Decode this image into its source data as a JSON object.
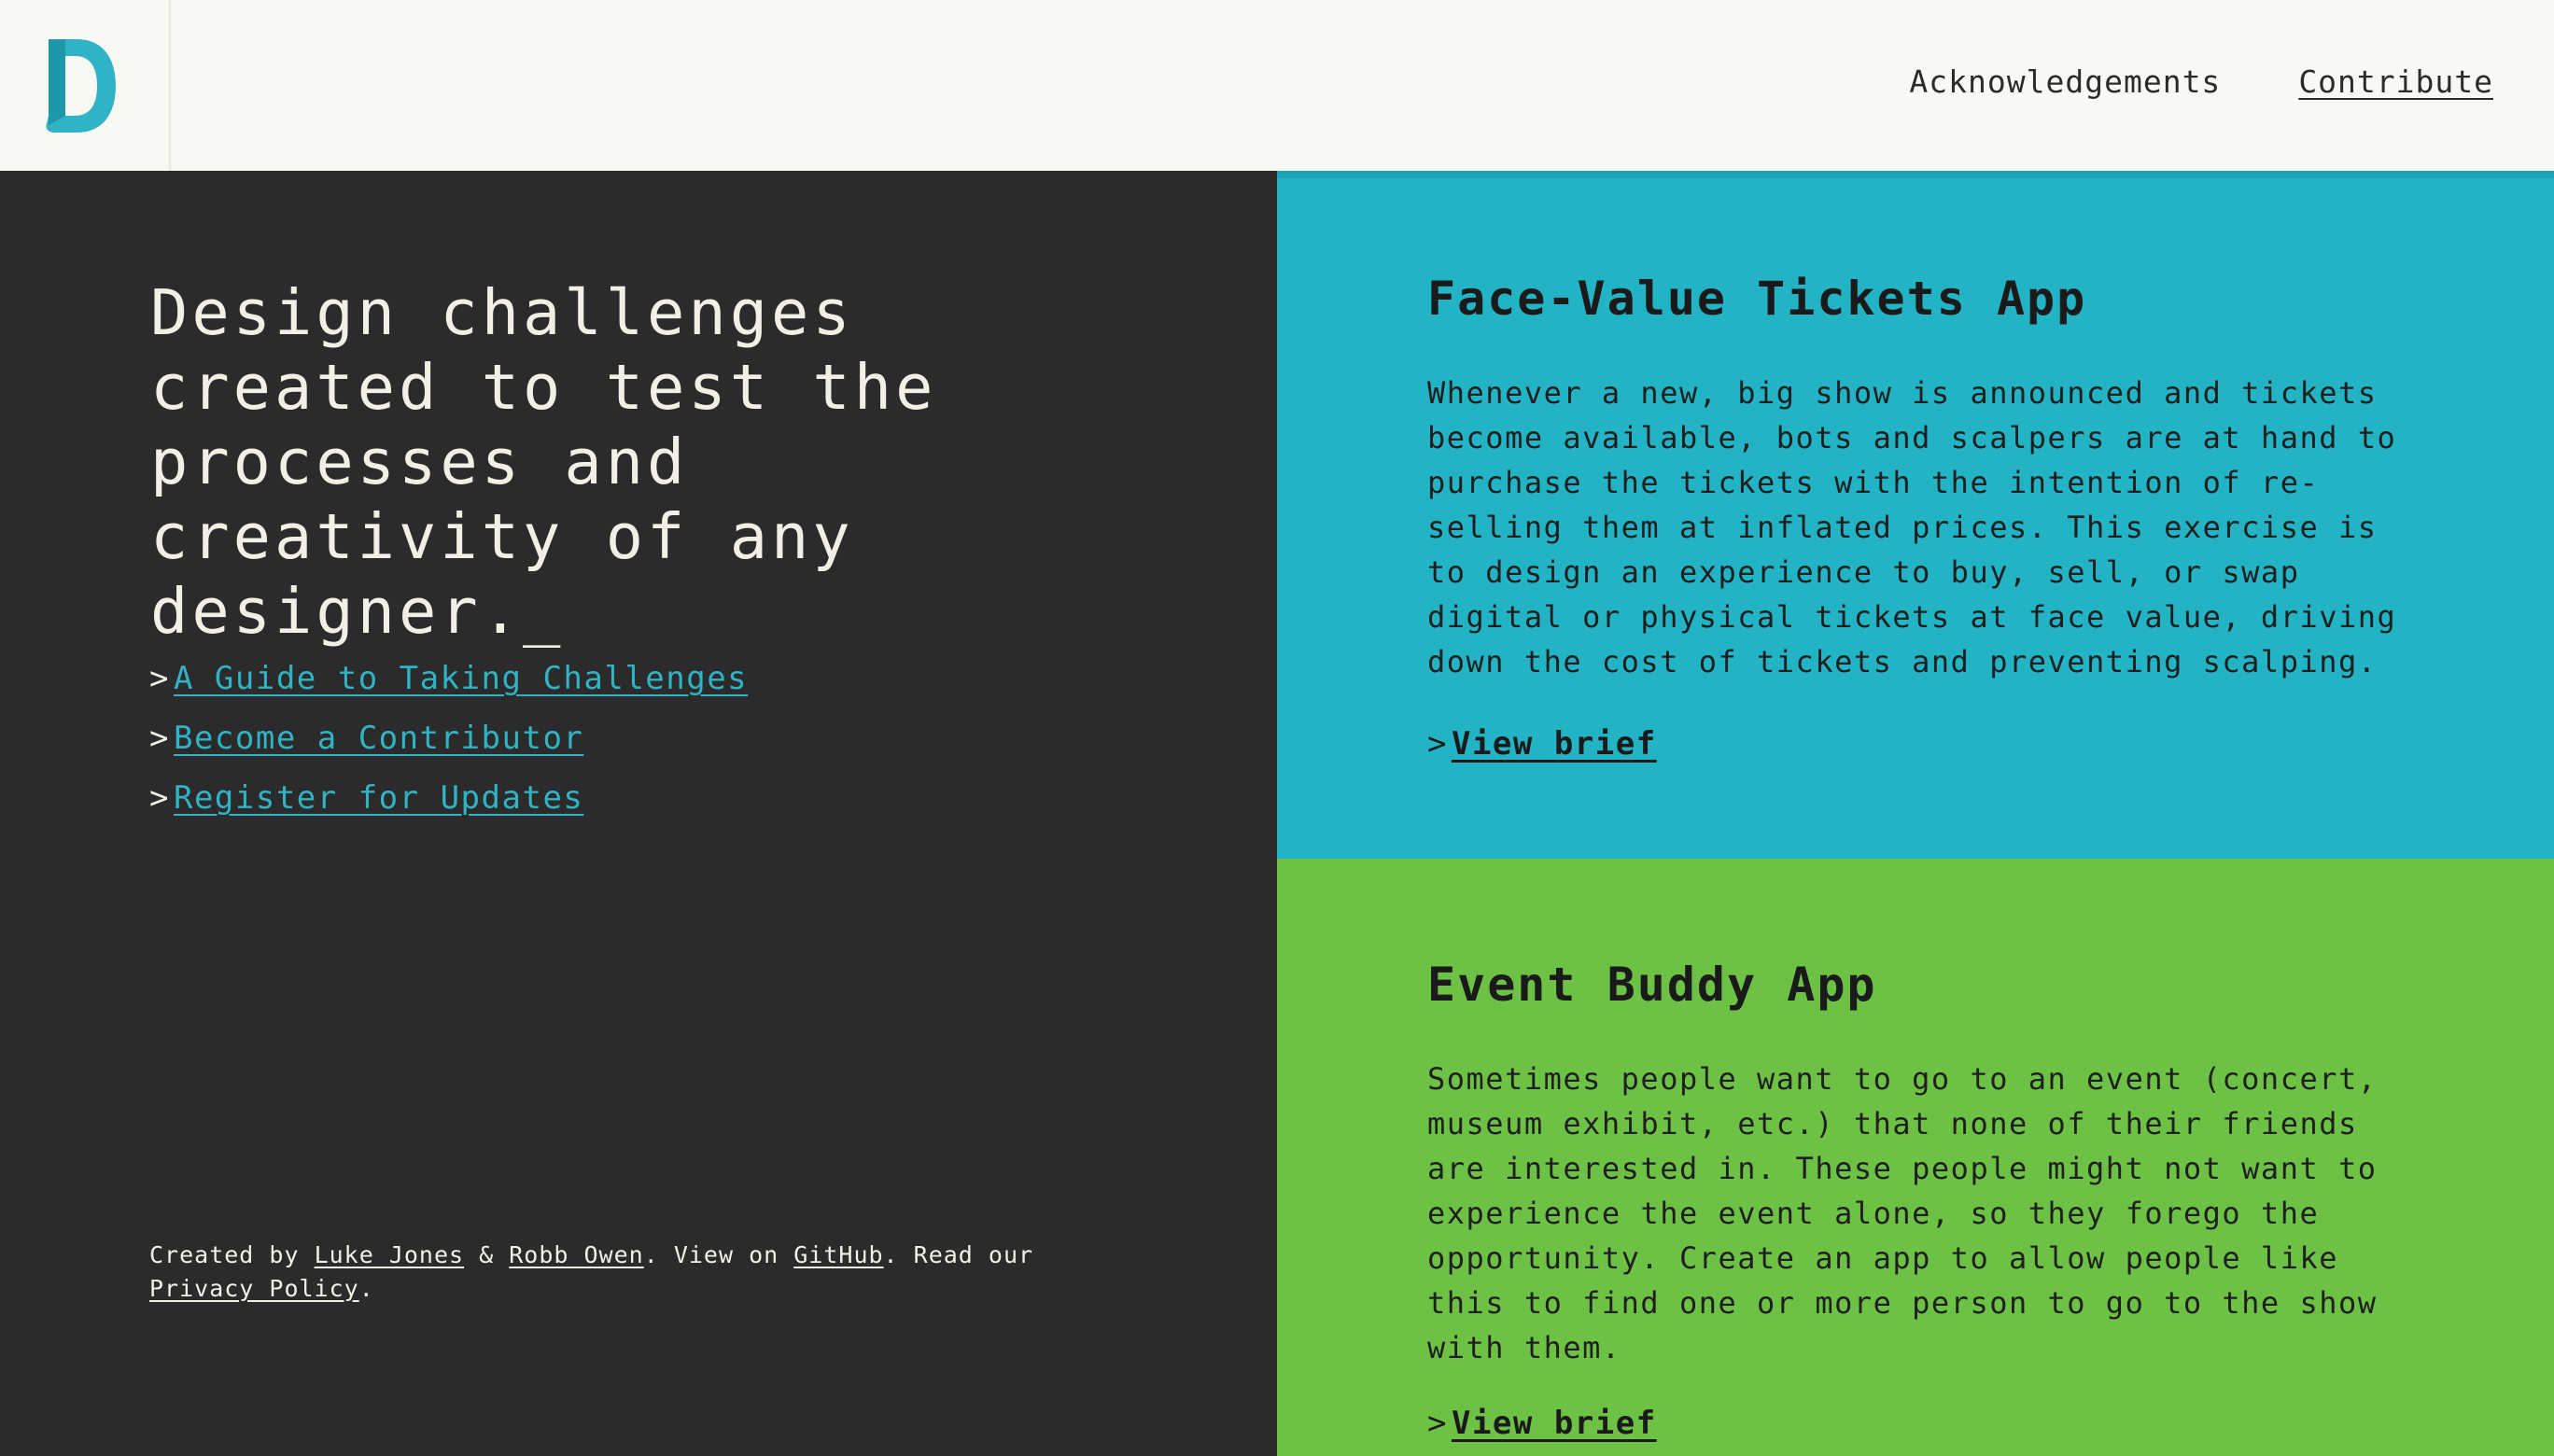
{
  "colors": {
    "header_bg": "#f9f9f4",
    "dark_bg": "#2b2b2b",
    "accent_teal": "#22b3c4",
    "accent_green": "#6dc245",
    "link_teal": "#2fb3c5"
  },
  "header": {
    "logo_icon": "letter-d-logo",
    "nav": {
      "acknowledgements": "Acknowledgements",
      "contribute": "Contribute"
    }
  },
  "hero": {
    "headline": "Design challenges created to test the processes and creativity of any designer._",
    "links": [
      {
        "caret": ">",
        "label": "A Guide to Taking Challenges"
      },
      {
        "caret": ">",
        "label": "Become a Contributor"
      },
      {
        "caret": ">",
        "label": "Register for Updates"
      }
    ]
  },
  "footer": {
    "created_by": "Created by ",
    "author1": "Luke Jones",
    "amp": " & ",
    "author2": "Robb Owen",
    "view_on": ". View on ",
    "github": "GitHub",
    "read_our": ". Read our ",
    "privacy": "Privacy Policy",
    "end": "."
  },
  "challenges": [
    {
      "title": "Face-Value Tickets App",
      "description": "Whenever a new, big show is announced and tickets become available, bots and scalpers are at hand to purchase the tickets with the intention of re-selling them at inflated prices. This exercise is to design an experience to buy, sell, or swap digital or physical tickets at face value, driving down the cost of tickets and preventing scalping.",
      "caret": ">",
      "link": "View brief"
    },
    {
      "title": "Event Buddy App",
      "description": "Sometimes people want to go to an event (concert, museum exhibit, etc.) that none of their friends are interested in. These people might not want to experience the event alone, so they forego the opportunity. Create an app to allow people like this to find one or more person to go to the show with them.",
      "caret": ">",
      "link": "View brief"
    }
  ]
}
